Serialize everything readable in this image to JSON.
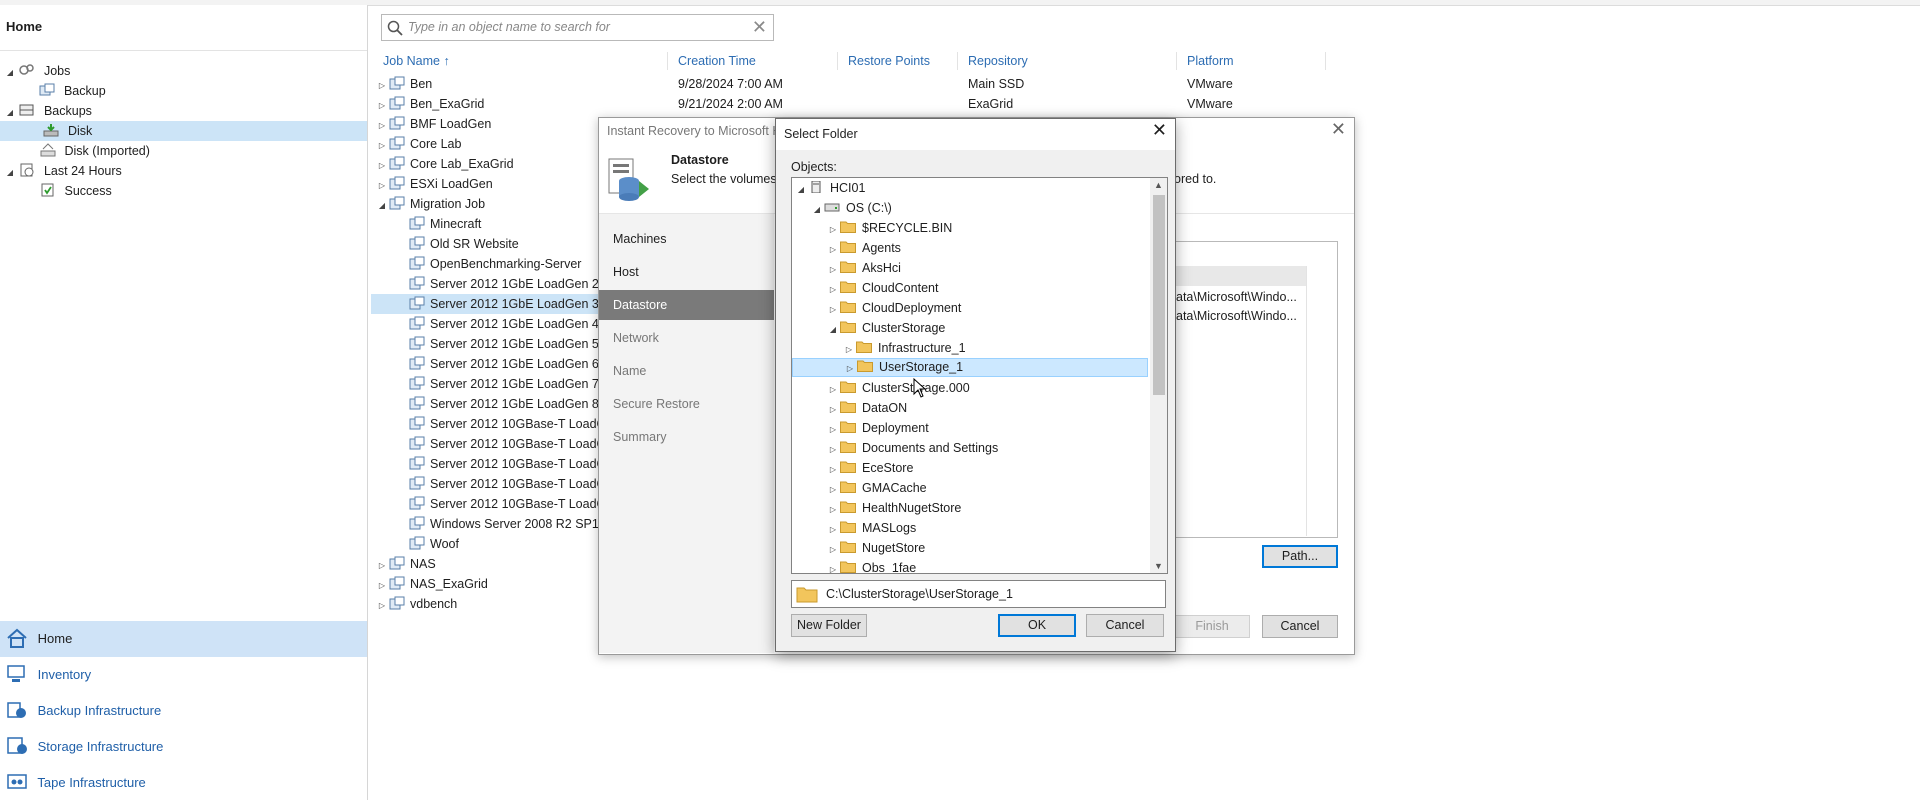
{
  "left_nav": {
    "title": "Home",
    "tree": [
      {
        "label": "Jobs",
        "icon": "jobs-icon",
        "tri": "◢"
      },
      {
        "label": "Backup",
        "icon": "backup-job-icon",
        "tri": ""
      },
      {
        "label": "Backups",
        "icon": "backups-icon",
        "tri": "◢"
      },
      {
        "label": "Disk",
        "icon": "disk-icon",
        "tri": ""
      },
      {
        "label": "Disk (Imported)",
        "icon": "disk-imported-icon",
        "tri": ""
      },
      {
        "label": "Last 24 Hours",
        "icon": "history-icon",
        "tri": "◢"
      },
      {
        "label": "Success",
        "icon": "success-icon",
        "tri": ""
      }
    ],
    "bottom_nav": [
      {
        "label": "Home",
        "icon": "home-icon"
      },
      {
        "label": "Inventory",
        "icon": "inventory-icon"
      },
      {
        "label": "Backup Infrastructure",
        "icon": "backup-infrastructure-icon"
      },
      {
        "label": "Storage Infrastructure",
        "icon": "storage-infrastructure-icon"
      },
      {
        "label": "Tape Infrastructure",
        "icon": "tape-infrastructure-icon"
      }
    ]
  },
  "search": {
    "placeholder": "Type in an object name to search for"
  },
  "table": {
    "columns": [
      "Job Name",
      "Creation Time",
      "Restore Points",
      "Repository",
      "Platform"
    ],
    "sort_indicator": "↑",
    "rows": [
      {
        "name": "Ben",
        "creation": "9/28/2024 7:00 AM",
        "repository": "Main SSD",
        "platform": "VMware"
      },
      {
        "name": "Ben_ExaGrid",
        "creation": "9/21/2024 2:00 AM",
        "repository": "ExaGrid",
        "platform": "VMware"
      },
      {
        "name": "BMF LoadGen"
      },
      {
        "name": "Core Lab"
      },
      {
        "name": "Core Lab_ExaGrid"
      },
      {
        "name": "ESXi LoadGen"
      },
      {
        "name": "Migration Job"
      },
      {
        "name": "Minecraft"
      },
      {
        "name": "Old SR Website"
      },
      {
        "name": "OpenBenchmarking-Server"
      },
      {
        "name": "Server 2012 1GbE LoadGen 2"
      },
      {
        "name": "Server 2012 1GbE LoadGen 3"
      },
      {
        "name": "Server 2012 1GbE LoadGen 4"
      },
      {
        "name": "Server 2012 1GbE LoadGen 5"
      },
      {
        "name": "Server 2012 1GbE LoadGen 6"
      },
      {
        "name": "Server 2012 1GbE LoadGen 7"
      },
      {
        "name": "Server 2012 1GbE LoadGen 8"
      },
      {
        "name": "Server 2012 10GBase-T LoadGe"
      },
      {
        "name": "Server 2012 10GBase-T LoadGe"
      },
      {
        "name": "Server 2012 10GBase-T LoadGe"
      },
      {
        "name": "Server 2012 10GBase-T LoadGe"
      },
      {
        "name": "Server 2012 10GBase-T LoadGe"
      },
      {
        "name": "Windows Server 2008 R2 SP1"
      },
      {
        "name": "Woof"
      },
      {
        "name": "NAS"
      },
      {
        "name": "NAS_ExaGrid"
      },
      {
        "name": "vdbench"
      }
    ]
  },
  "instant_recovery": {
    "title": "Instant Recovery to Microsoft H",
    "step_title": "Datastore",
    "step_desc_left": "Select the volumes v",
    "step_desc_right": "ored to.",
    "nav": [
      "Machines",
      "Host",
      "Datastore",
      "Network",
      "Name",
      "Secure Restore",
      "Summary"
    ],
    "grid_rows": [
      "ata\\Microsoft\\Windo...",
      "ata\\Microsoft\\Windo..."
    ],
    "path_button": "Path...",
    "finish_button": "Finish",
    "cancel_button": "Cancel"
  },
  "select_folder": {
    "title": "Select Folder",
    "objects_label": "Objects:",
    "tree": [
      {
        "label": "HCI01",
        "level": 0,
        "tri": "◢",
        "icon": "server"
      },
      {
        "label": "OS (C:\\)",
        "level": 1,
        "tri": "◢",
        "icon": "drive"
      },
      {
        "label": "$RECYCLE.BIN",
        "level": 2,
        "tri": "▷",
        "icon": "folder"
      },
      {
        "label": "Agents",
        "level": 2,
        "tri": "▷",
        "icon": "folder"
      },
      {
        "label": "AksHci",
        "level": 2,
        "tri": "▷",
        "icon": "folder"
      },
      {
        "label": "CloudContent",
        "level": 2,
        "tri": "▷",
        "icon": "folder"
      },
      {
        "label": "CloudDeployment",
        "level": 2,
        "tri": "▷",
        "icon": "folder"
      },
      {
        "label": "ClusterStorage",
        "level": 2,
        "tri": "◢",
        "icon": "folder"
      },
      {
        "label": "Infrastructure_1",
        "level": 3,
        "tri": "▷",
        "icon": "folder"
      },
      {
        "label": "UserStorage_1",
        "level": 3,
        "tri": "▷",
        "icon": "folder",
        "selected": true
      },
      {
        "label": "ClusterStorage.000",
        "level": 2,
        "tri": "▷",
        "icon": "folder"
      },
      {
        "label": "DataON",
        "level": 2,
        "tri": "▷",
        "icon": "folder"
      },
      {
        "label": "Deployment",
        "level": 2,
        "tri": "▷",
        "icon": "folder"
      },
      {
        "label": "Documents and Settings",
        "level": 2,
        "tri": "▷",
        "icon": "folder"
      },
      {
        "label": "EceStore",
        "level": 2,
        "tri": "▷",
        "icon": "folder"
      },
      {
        "label": "GMACache",
        "level": 2,
        "tri": "▷",
        "icon": "folder"
      },
      {
        "label": "HealthNugetStore",
        "level": 2,
        "tri": "▷",
        "icon": "folder"
      },
      {
        "label": "MASLogs",
        "level": 2,
        "tri": "▷",
        "icon": "folder"
      },
      {
        "label": "NugetStore",
        "level": 2,
        "tri": "▷",
        "icon": "folder"
      },
      {
        "label": "Obs_1fae",
        "level": 2,
        "tri": "▷",
        "icon": "folder"
      }
    ],
    "path_value": "C:\\ClusterStorage\\UserStorage_1",
    "new_folder_button": "New Folder",
    "ok_button": "OK",
    "cancel_button": "Cancel"
  },
  "colors": {
    "accent": "#0078d7",
    "selection": "#cce4f7",
    "link": "#2d6db3",
    "folder": "#f2c55c"
  }
}
